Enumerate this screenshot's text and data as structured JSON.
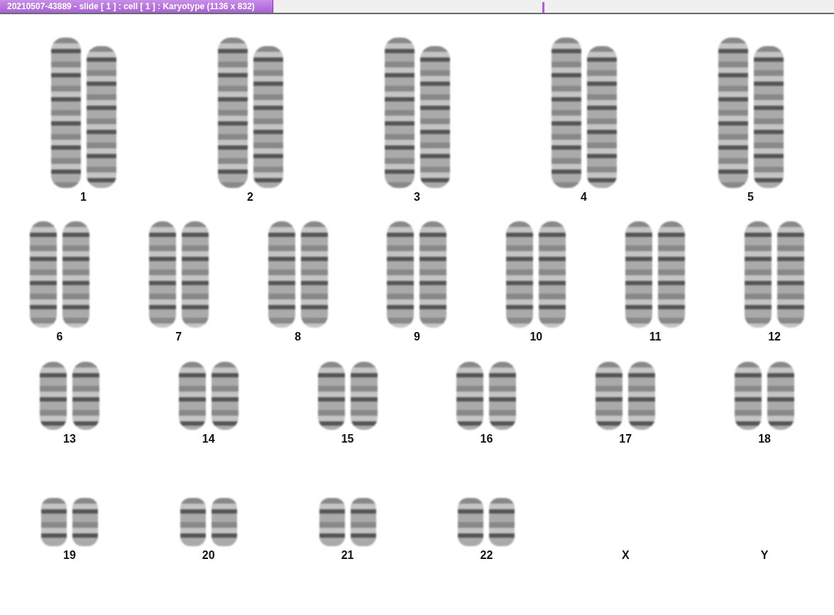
{
  "window": {
    "title": "20210507-43889 - slide [ 1 ] : cell [ 1 ] : Karyotype  (1136 x 832)"
  },
  "rows": [
    {
      "pairs": [
        {
          "label": "1",
          "kind": "pair"
        },
        {
          "label": "2",
          "kind": "pair"
        },
        {
          "label": "3",
          "kind": "pair"
        },
        {
          "label": "4",
          "kind": "pair"
        },
        {
          "label": "5",
          "kind": "pair"
        }
      ]
    },
    {
      "pairs": [
        {
          "label": "6",
          "kind": "pair"
        },
        {
          "label": "7",
          "kind": "pair"
        },
        {
          "label": "8",
          "kind": "pair"
        },
        {
          "label": "9",
          "kind": "pair"
        },
        {
          "label": "10",
          "kind": "pair"
        },
        {
          "label": "11",
          "kind": "pair"
        },
        {
          "label": "12",
          "kind": "pair"
        }
      ]
    },
    {
      "pairs": [
        {
          "label": "13",
          "kind": "pair"
        },
        {
          "label": "14",
          "kind": "pair"
        },
        {
          "label": "15",
          "kind": "pair"
        },
        {
          "label": "16",
          "kind": "pair"
        },
        {
          "label": "17",
          "kind": "pair"
        },
        {
          "label": "18",
          "kind": "pair"
        }
      ]
    },
    {
      "pairs": [
        {
          "label": "19",
          "kind": "pair"
        },
        {
          "label": "20",
          "kind": "pair"
        },
        {
          "label": "21",
          "kind": "pair"
        },
        {
          "label": "22",
          "kind": "pair"
        },
        {
          "label": "X",
          "kind": "empty"
        },
        {
          "label": "Y",
          "kind": "empty"
        }
      ]
    }
  ]
}
